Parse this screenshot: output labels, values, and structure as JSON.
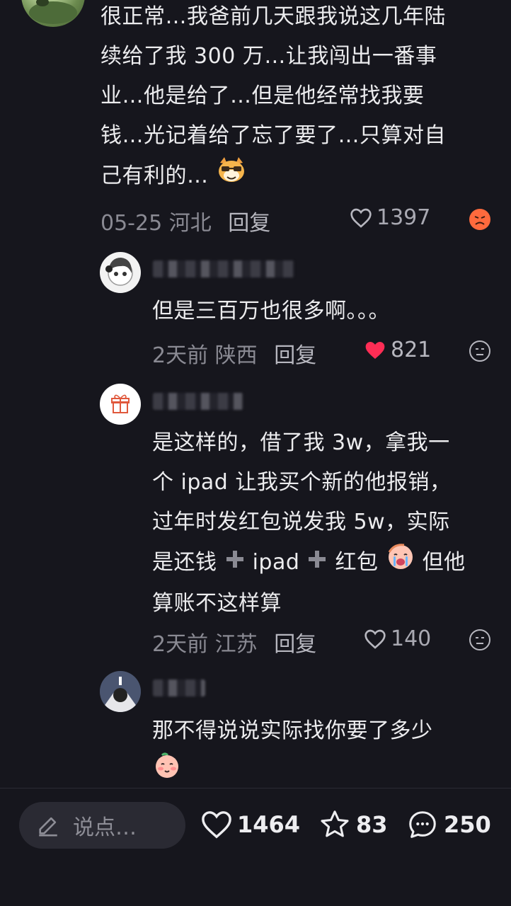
{
  "main_comment": {
    "text_lines": [
      "很正常…我爸前几天跟我说这几年陆",
      "续给了我 300 万…让我闯出一番事",
      "业…他是给了…但是他经常找我要",
      "钱…光记着给了忘了要了…只算对自",
      "己有利的…"
    ],
    "date": "05-25",
    "location": "河北",
    "reply_label": "回复",
    "likes": "1397"
  },
  "replies": [
    {
      "text_lines": [
        "但是三百万也很多啊。。。"
      ],
      "time": "2天前",
      "location": "陕西",
      "reply_label": "回复",
      "likes": "821",
      "liked": true
    },
    {
      "text_lines": [
        "是这样的，借了我 3w，拿我一",
        "个 ipad 让我买个新的他报销，",
        "过年时发红包说发我 5w，实际"
      ],
      "line4_a": "是还钱",
      "line4_b": "ipad",
      "line4_c": "红包",
      "line4_d": "但他",
      "line5": "算账不这样算",
      "time": "2天前",
      "location": "江苏",
      "reply_label": "回复",
      "likes": "140",
      "liked": false
    },
    {
      "text_lines": [
        "那不得说说实际找你要了多少"
      ],
      "time": "",
      "location": "",
      "reply_label": "",
      "likes": ""
    }
  ],
  "bottom_bar": {
    "input_placeholder": "说点…",
    "likes": "1464",
    "favorites": "83",
    "comments": "250"
  },
  "colors": {
    "background": "#16161d",
    "liked_heart": "#ff2d55",
    "angry_emoji": "#ff6a3d"
  },
  "icons": [
    "heart-icon",
    "angry-face-icon",
    "neutral-face-icon",
    "pencil-icon",
    "star-icon",
    "chat-bubble-icon",
    "gift-icon",
    "plus-icon"
  ]
}
